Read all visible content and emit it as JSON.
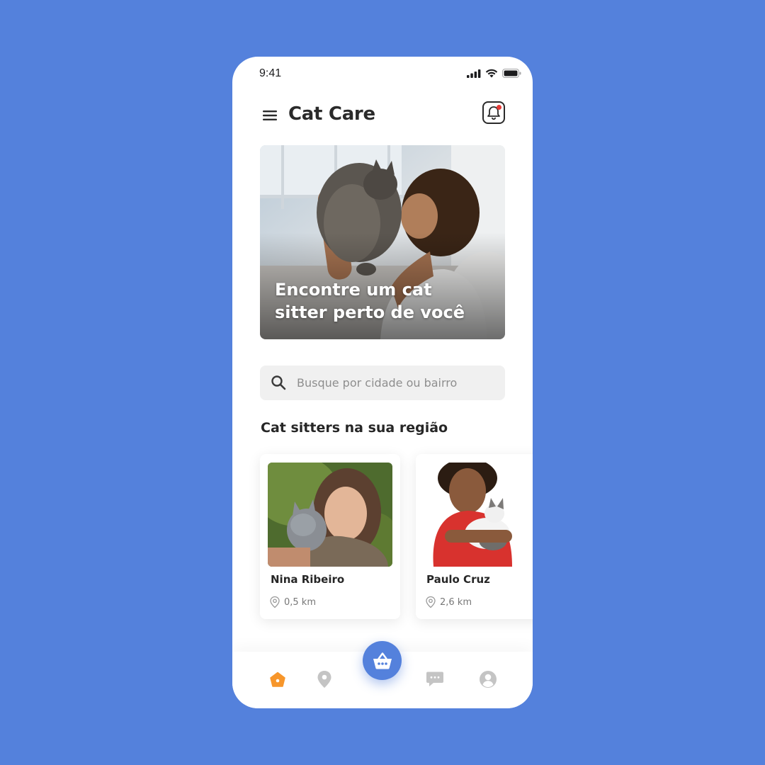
{
  "status": {
    "time": "9:41"
  },
  "header": {
    "title": "Cat Care"
  },
  "hero": {
    "line1": "Encontre um cat",
    "line2": "sitter perto de você"
  },
  "search": {
    "placeholder": "Busque por cidade ou bairro"
  },
  "section": {
    "title": "Cat sitters na sua região"
  },
  "sitters": [
    {
      "name": "Nina Ribeiro",
      "distance": "0,5 km"
    },
    {
      "name": "Paulo Cruz",
      "distance": "2,6 km"
    }
  ],
  "nav": {
    "items": [
      "home-icon",
      "location-pin-icon",
      "basket-icon",
      "chat-icon",
      "profile-icon"
    ],
    "active": "home-icon"
  },
  "colors": {
    "background": "#5481dc",
    "accent": "#5481dc",
    "active_nav": "#f7962b",
    "notification": "#e53935",
    "inactive_nav": "#c4c4c4"
  }
}
